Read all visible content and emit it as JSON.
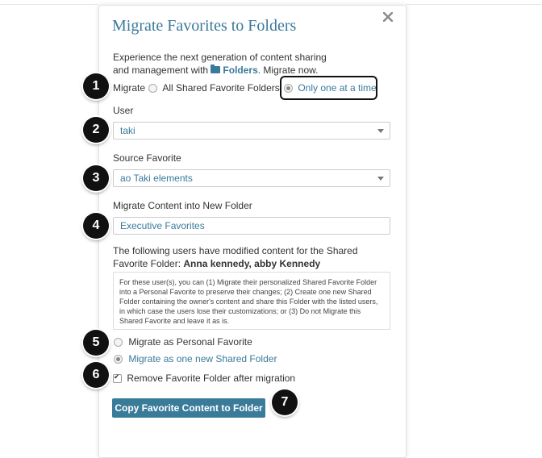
{
  "dialog": {
    "title": "Migrate Favorites to Folders",
    "intro_line1": "Experience the next generation of content sharing",
    "intro_prefix": "and management with",
    "intro_link": "Folders",
    "intro_suffix": ". Migrate now.",
    "migrate_label": "Migrate",
    "migrate_options": [
      "All Shared Favorite Folders",
      "Only one at a time"
    ],
    "user_label": "User",
    "user_value": "taki",
    "source_label": "Source Favorite",
    "source_value": "ao Taki elements",
    "new_folder_label": "Migrate Content into New Folder",
    "new_folder_value": "Executive Favorites",
    "modified_text": "The following users have modified content for the Shared Favorite Folder:",
    "modified_users": "Anna kennedy, abby Kennedy",
    "info_text": "For these user(s), you can (1) Migrate their personalized Shared Favorite Folder into a Personal Favorite to preserve their changes; (2) Create one new Shared Folder containing the owner's content and share this Folder with the listed users, in which case the users lose their customizations; or (3) Do not Migrate this Shared Favorite and leave it as is.",
    "option_personal": "Migrate as Personal Favorite",
    "option_shared": "Migrate as one new Shared Folder",
    "remove_label": "Remove Favorite Folder after migration",
    "submit_label": "Copy Favorite Content to Folder"
  },
  "callouts": [
    "1",
    "2",
    "3",
    "4",
    "5",
    "6",
    "7"
  ],
  "icons": [
    "close-icon",
    "folder-icon",
    "chevron-down-icon"
  ],
  "colors": {
    "accent": "#3a7a9a",
    "button": "#3b7b9a",
    "callout": "#111111"
  }
}
